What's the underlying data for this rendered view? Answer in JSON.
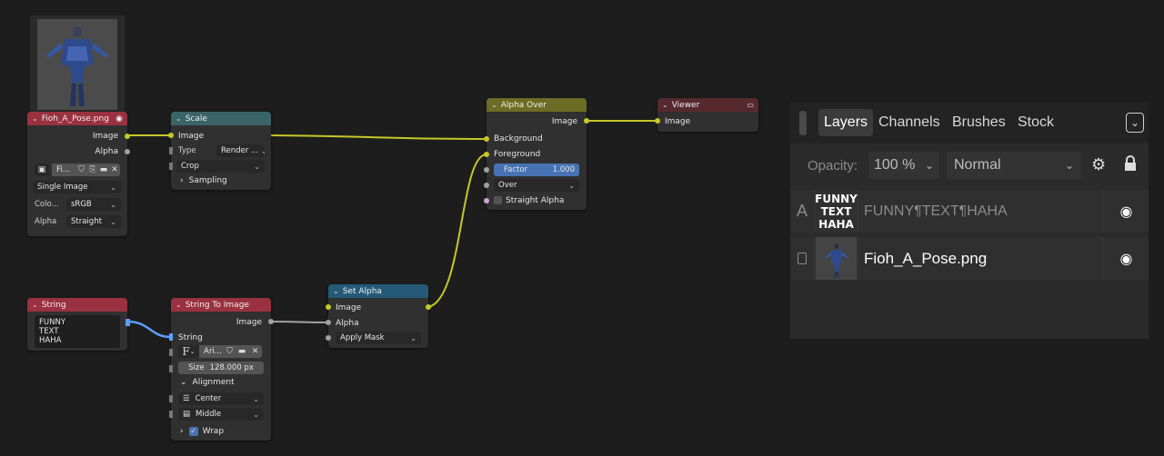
{
  "nodes": {
    "image": {
      "title": "Fioh_A_Pose.png",
      "out_image": "Image",
      "out_alpha": "Alpha",
      "file_name": "Fi...",
      "source": "Single Image",
      "color_label": "Colo...",
      "color_value": "sRGB",
      "alpha_label": "Alpha",
      "alpha_value": "Straight"
    },
    "scale": {
      "title": "Scale",
      "in_image": "Image",
      "type_label": "Type",
      "type_value": "Render ...",
      "crop_value": "Crop",
      "sampling": "Sampling"
    },
    "alpha_over": {
      "title": "Alpha Over",
      "out_image": "Image",
      "background": "Background",
      "foreground": "Foreground",
      "factor_label": "Factor",
      "factor_value": "1.000",
      "mode": "Over",
      "straight_alpha": "Straight Alpha"
    },
    "viewer": {
      "title": "Viewer",
      "in_image": "Image"
    },
    "string": {
      "title": "String",
      "line1": "FUNNY",
      "line2": "TEXT",
      "line3": "HAHA"
    },
    "string_to_image": {
      "title": "String To Image",
      "out_image": "Image",
      "in_string": "String",
      "font_glyph": "F",
      "font_name": "Ari...",
      "size_label": "Size",
      "size_value": "128.000 px",
      "alignment": "Alignment",
      "h_align": "Center",
      "v_align": "Middle",
      "wrap": "Wrap"
    },
    "set_alpha": {
      "title": "Set Alpha",
      "out_image": "Image",
      "in_image": "Image",
      "in_alpha": "Alpha",
      "mode": "Apply Mask"
    }
  },
  "colors": {
    "image_header": "#9a3140",
    "scale_header": "#3b6468",
    "alpha_over_header": "#6c6c25",
    "viewer_header": "#56292f",
    "string_header": "#9a3140",
    "string_to_image_header": "#9a3140",
    "set_alpha_header": "#245a78",
    "wire_yellow": "#c7c729",
    "wire_gray": "#a1a1a1",
    "wire_blue": "#5aa0ff",
    "factor_blue": "#4772b3"
  },
  "layers_panel": {
    "tabs": [
      "Layers",
      "Channels",
      "Brushes",
      "Stock"
    ],
    "opacity_label": "Opacity:",
    "opacity_value": "100 %",
    "blend_mode": "Normal",
    "layers": [
      {
        "kind": "A",
        "thumb_line1": "FUNNY",
        "thumb_line2": "TEXT",
        "thumb_line3": "HAHA",
        "name": "FUNNY¶TEXT¶HAHA"
      },
      {
        "name": "Fioh_A_Pose.png"
      }
    ]
  }
}
